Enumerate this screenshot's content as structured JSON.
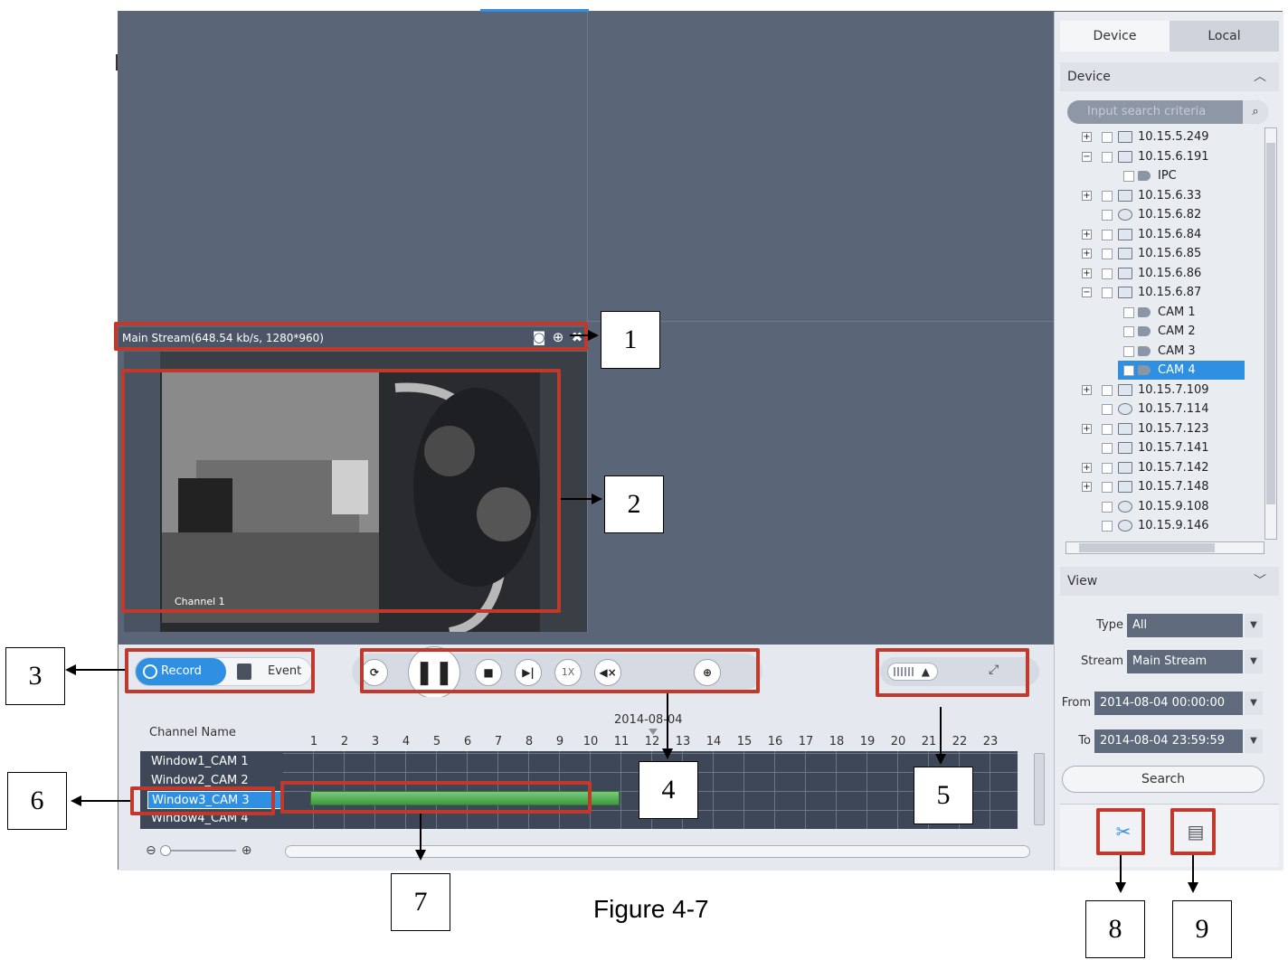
{
  "stream_info": "Main Stream(648.54 kb/s, 1280*960)",
  "video": {
    "channel_label": "Channel 1"
  },
  "controls": {
    "record_label": "Record",
    "event_label": "Event",
    "speed_label": "1X"
  },
  "timeline": {
    "channel_header": "Channel Name",
    "date": "2014-08-04",
    "hours": [
      "1",
      "2",
      "3",
      "4",
      "5",
      "6",
      "7",
      "8",
      "9",
      "10",
      "11",
      "12",
      "13",
      "14",
      "15",
      "16",
      "17",
      "18",
      "19",
      "20",
      "21",
      "22",
      "23"
    ],
    "rows": [
      "Window1_CAM 1",
      "Window2_CAM 2",
      "Window3_CAM 3",
      "Window4_CAM 4"
    ],
    "selected_row": "Window3_CAM 3"
  },
  "sidebar": {
    "tabs": [
      "Device",
      "Local"
    ],
    "device_section": "Device",
    "search_placeholder": "Input search criteria",
    "tree": [
      {
        "label": "10.15.5.249",
        "expander": "+",
        "icon": "device"
      },
      {
        "label": "10.15.6.191",
        "expander": "-",
        "icon": "device"
      },
      {
        "label": "IPC",
        "expander": "",
        "icon": "camera",
        "child": true
      },
      {
        "label": "10.15.6.33",
        "expander": "+",
        "icon": "device"
      },
      {
        "label": "10.15.6.82",
        "expander": "",
        "icon": "dome"
      },
      {
        "label": "10.15.6.84",
        "expander": "+",
        "icon": "device"
      },
      {
        "label": "10.15.6.85",
        "expander": "+",
        "icon": "device"
      },
      {
        "label": "10.15.6.86",
        "expander": "+",
        "icon": "device"
      },
      {
        "label": "10.15.6.87",
        "expander": "-",
        "icon": "device"
      },
      {
        "label": "CAM 1",
        "expander": "",
        "icon": "camera",
        "child": true
      },
      {
        "label": "CAM 2",
        "expander": "",
        "icon": "camera",
        "child": true
      },
      {
        "label": "CAM 3",
        "expander": "",
        "icon": "camera",
        "child": true
      },
      {
        "label": "CAM 4",
        "expander": "",
        "icon": "camera",
        "child": true,
        "selected": true
      },
      {
        "label": "10.15.7.109",
        "expander": "+",
        "icon": "device"
      },
      {
        "label": "10.15.7.114",
        "expander": "",
        "icon": "dome"
      },
      {
        "label": "10.15.7.123",
        "expander": "+",
        "icon": "device"
      },
      {
        "label": "10.15.7.141",
        "expander": "",
        "icon": "device"
      },
      {
        "label": "10.15.7.142",
        "expander": "+",
        "icon": "device"
      },
      {
        "label": "10.15.7.148",
        "expander": "+",
        "icon": "device"
      },
      {
        "label": "10.15.9.108",
        "expander": "",
        "icon": "dome"
      },
      {
        "label": "10.15.9.146",
        "expander": "",
        "icon": "dome"
      }
    ],
    "view_section": "View",
    "type_label": "Type",
    "type_value": "All",
    "stream_label": "Stream",
    "stream_value": "Main Stream",
    "from_label": "From",
    "from_value": "2014-08-04 00:00:00",
    "to_label": "To",
    "to_value": "2014-08-04 23:59:59",
    "search_button": "Search"
  },
  "annotations": [
    "1",
    "2",
    "3",
    "4",
    "5",
    "6",
    "7",
    "8",
    "9"
  ],
  "caption": "Figure 4-7",
  "colors": {
    "accent": "#2f8fe0",
    "highlight": "#c0392b",
    "record_bar": "#3d9a3d",
    "video_bg": "#5a6577"
  }
}
